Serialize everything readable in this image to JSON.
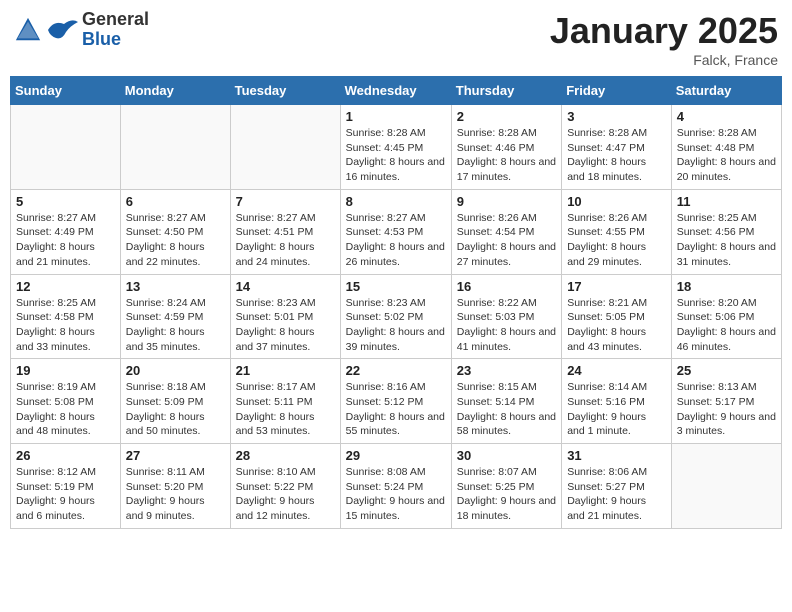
{
  "logo": {
    "general": "General",
    "blue": "Blue"
  },
  "calendar": {
    "title": "January 2025",
    "subtitle": "Falck, France",
    "days_of_week": [
      "Sunday",
      "Monday",
      "Tuesday",
      "Wednesday",
      "Thursday",
      "Friday",
      "Saturday"
    ],
    "weeks": [
      [
        {
          "num": "",
          "info": ""
        },
        {
          "num": "",
          "info": ""
        },
        {
          "num": "",
          "info": ""
        },
        {
          "num": "1",
          "info": "Sunrise: 8:28 AM\nSunset: 4:45 PM\nDaylight: 8 hours\nand 16 minutes."
        },
        {
          "num": "2",
          "info": "Sunrise: 8:28 AM\nSunset: 4:46 PM\nDaylight: 8 hours\nand 17 minutes."
        },
        {
          "num": "3",
          "info": "Sunrise: 8:28 AM\nSunset: 4:47 PM\nDaylight: 8 hours\nand 18 minutes."
        },
        {
          "num": "4",
          "info": "Sunrise: 8:28 AM\nSunset: 4:48 PM\nDaylight: 8 hours\nand 20 minutes."
        }
      ],
      [
        {
          "num": "5",
          "info": "Sunrise: 8:27 AM\nSunset: 4:49 PM\nDaylight: 8 hours\nand 21 minutes."
        },
        {
          "num": "6",
          "info": "Sunrise: 8:27 AM\nSunset: 4:50 PM\nDaylight: 8 hours\nand 22 minutes."
        },
        {
          "num": "7",
          "info": "Sunrise: 8:27 AM\nSunset: 4:51 PM\nDaylight: 8 hours\nand 24 minutes."
        },
        {
          "num": "8",
          "info": "Sunrise: 8:27 AM\nSunset: 4:53 PM\nDaylight: 8 hours\nand 26 minutes."
        },
        {
          "num": "9",
          "info": "Sunrise: 8:26 AM\nSunset: 4:54 PM\nDaylight: 8 hours\nand 27 minutes."
        },
        {
          "num": "10",
          "info": "Sunrise: 8:26 AM\nSunset: 4:55 PM\nDaylight: 8 hours\nand 29 minutes."
        },
        {
          "num": "11",
          "info": "Sunrise: 8:25 AM\nSunset: 4:56 PM\nDaylight: 8 hours\nand 31 minutes."
        }
      ],
      [
        {
          "num": "12",
          "info": "Sunrise: 8:25 AM\nSunset: 4:58 PM\nDaylight: 8 hours\nand 33 minutes."
        },
        {
          "num": "13",
          "info": "Sunrise: 8:24 AM\nSunset: 4:59 PM\nDaylight: 8 hours\nand 35 minutes."
        },
        {
          "num": "14",
          "info": "Sunrise: 8:23 AM\nSunset: 5:01 PM\nDaylight: 8 hours\nand 37 minutes."
        },
        {
          "num": "15",
          "info": "Sunrise: 8:23 AM\nSunset: 5:02 PM\nDaylight: 8 hours\nand 39 minutes."
        },
        {
          "num": "16",
          "info": "Sunrise: 8:22 AM\nSunset: 5:03 PM\nDaylight: 8 hours\nand 41 minutes."
        },
        {
          "num": "17",
          "info": "Sunrise: 8:21 AM\nSunset: 5:05 PM\nDaylight: 8 hours\nand 43 minutes."
        },
        {
          "num": "18",
          "info": "Sunrise: 8:20 AM\nSunset: 5:06 PM\nDaylight: 8 hours\nand 46 minutes."
        }
      ],
      [
        {
          "num": "19",
          "info": "Sunrise: 8:19 AM\nSunset: 5:08 PM\nDaylight: 8 hours\nand 48 minutes."
        },
        {
          "num": "20",
          "info": "Sunrise: 8:18 AM\nSunset: 5:09 PM\nDaylight: 8 hours\nand 50 minutes."
        },
        {
          "num": "21",
          "info": "Sunrise: 8:17 AM\nSunset: 5:11 PM\nDaylight: 8 hours\nand 53 minutes."
        },
        {
          "num": "22",
          "info": "Sunrise: 8:16 AM\nSunset: 5:12 PM\nDaylight: 8 hours\nand 55 minutes."
        },
        {
          "num": "23",
          "info": "Sunrise: 8:15 AM\nSunset: 5:14 PM\nDaylight: 8 hours\nand 58 minutes."
        },
        {
          "num": "24",
          "info": "Sunrise: 8:14 AM\nSunset: 5:16 PM\nDaylight: 9 hours\nand 1 minute."
        },
        {
          "num": "25",
          "info": "Sunrise: 8:13 AM\nSunset: 5:17 PM\nDaylight: 9 hours\nand 3 minutes."
        }
      ],
      [
        {
          "num": "26",
          "info": "Sunrise: 8:12 AM\nSunset: 5:19 PM\nDaylight: 9 hours\nand 6 minutes."
        },
        {
          "num": "27",
          "info": "Sunrise: 8:11 AM\nSunset: 5:20 PM\nDaylight: 9 hours\nand 9 minutes."
        },
        {
          "num": "28",
          "info": "Sunrise: 8:10 AM\nSunset: 5:22 PM\nDaylight: 9 hours\nand 12 minutes."
        },
        {
          "num": "29",
          "info": "Sunrise: 8:08 AM\nSunset: 5:24 PM\nDaylight: 9 hours\nand 15 minutes."
        },
        {
          "num": "30",
          "info": "Sunrise: 8:07 AM\nSunset: 5:25 PM\nDaylight: 9 hours\nand 18 minutes."
        },
        {
          "num": "31",
          "info": "Sunrise: 8:06 AM\nSunset: 5:27 PM\nDaylight: 9 hours\nand 21 minutes."
        },
        {
          "num": "",
          "info": ""
        }
      ]
    ]
  }
}
